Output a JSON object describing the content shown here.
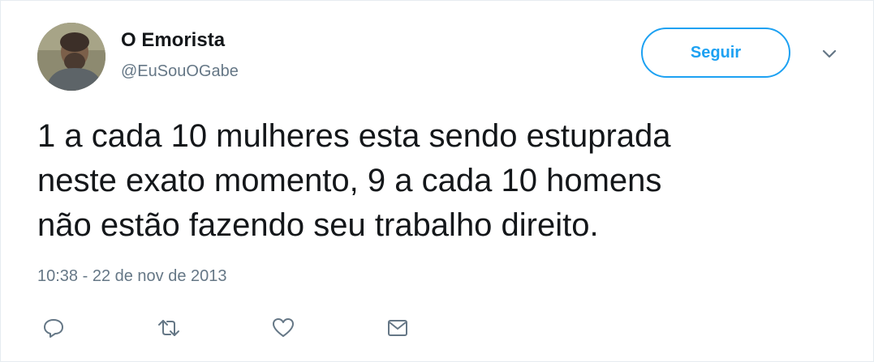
{
  "tweet": {
    "author_name": "O Emorista",
    "author_handle": "@EuSouOGabe",
    "follow_label": "Seguir",
    "lines": [
      "1 a cada 10 mulheres esta sendo estuprada",
      "neste exato momento, 9 a cada 10 homens",
      "não estão fazendo seu trabalho direito."
    ],
    "timestamp": "10:38 - 22 de nov de 2013"
  },
  "icons": {
    "more": "chevron-down-icon",
    "reply": "reply-icon",
    "retweet": "retweet-icon",
    "like": "heart-icon",
    "dm": "envelope-icon"
  },
  "colors": {
    "accent": "#1da1f2",
    "text": "#14171a",
    "secondary": "#657786",
    "border": "#e6ecf0"
  }
}
